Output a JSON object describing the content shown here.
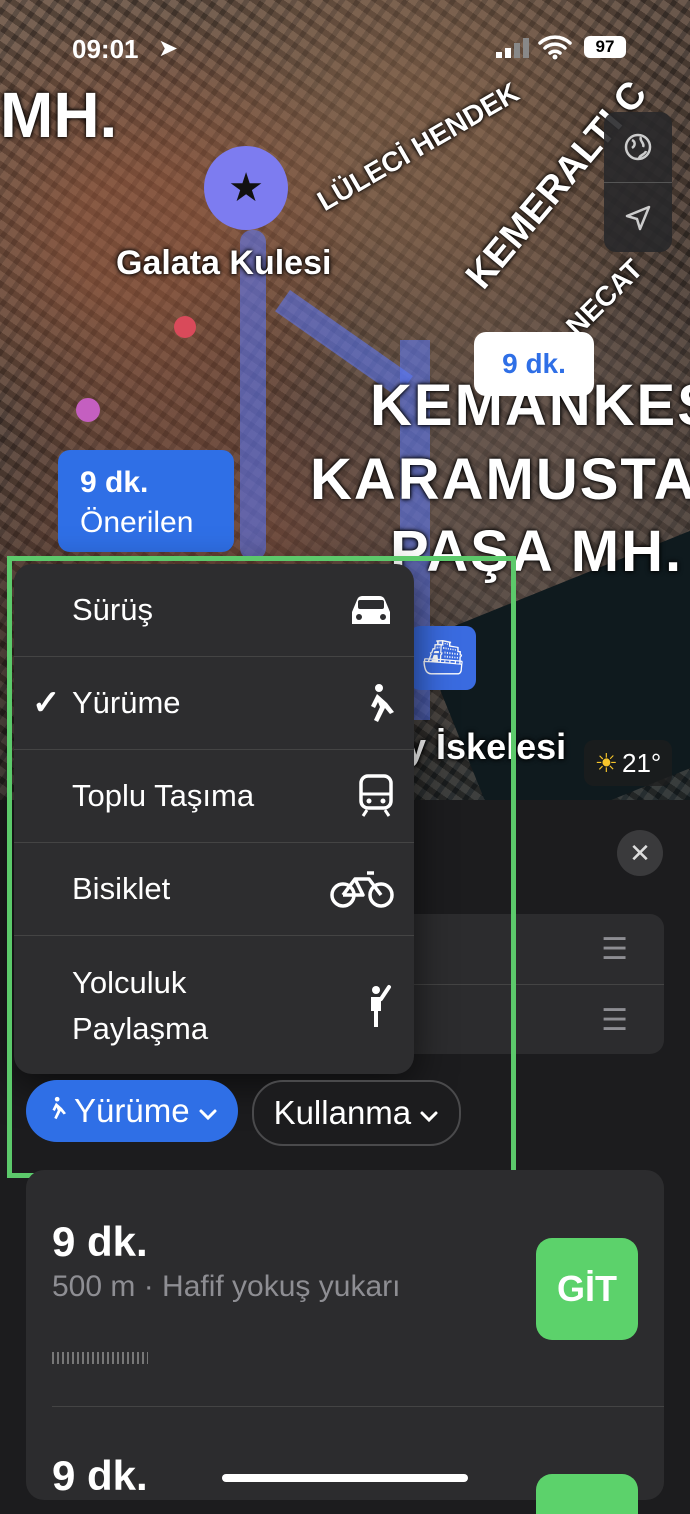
{
  "status_bar": {
    "time": "09:01",
    "battery": "97"
  },
  "map": {
    "labels": {
      "mh_left": "MH.",
      "luleci": "LÜLECİ HENDEK",
      "kemeralti": "KEMERALTI C",
      "galata": "Galata Kulesi",
      "kemankes_1": "KEMANKEŞ",
      "kemankes_2": "KARAMUSTAFA",
      "kemankes_3": "PAŞA MH.",
      "iskelesi": "y İskelesi",
      "necat": "NECAT"
    },
    "route_callout_blue": {
      "time": "9 dk.",
      "caption": "Önerilen"
    },
    "route_callout_white": {
      "time": "9 dk."
    },
    "weather": {
      "temp": "21°"
    }
  },
  "mode_menu": {
    "items": [
      {
        "label": "Sürüş",
        "icon": "car-icon",
        "checked": false
      },
      {
        "label": "Yürüme",
        "icon": "walk-icon",
        "checked": true
      },
      {
        "label": "Toplu Taşıma",
        "icon": "train-icon",
        "checked": false
      },
      {
        "label": "Bisiklet",
        "icon": "bicycle-icon",
        "checked": false
      },
      {
        "label": "Yolculuk Paylaşma",
        "icon": "rideshare-icon",
        "checked": false
      }
    ],
    "check_mark": "✓"
  },
  "filter_chips": {
    "mode_label": "Yürüme",
    "avoid_label": "Kullanma"
  },
  "routes": [
    {
      "duration": "9 dk.",
      "details": "500 m · Hafif yokuş yukarı",
      "go_label": "GİT"
    },
    {
      "duration": "9 dk."
    }
  ],
  "colors": {
    "accent_blue": "#2f6fe6",
    "go_green": "#5cd26b",
    "highlight_green": "#5cc96b",
    "menu_bg": "#2d2d2f"
  }
}
